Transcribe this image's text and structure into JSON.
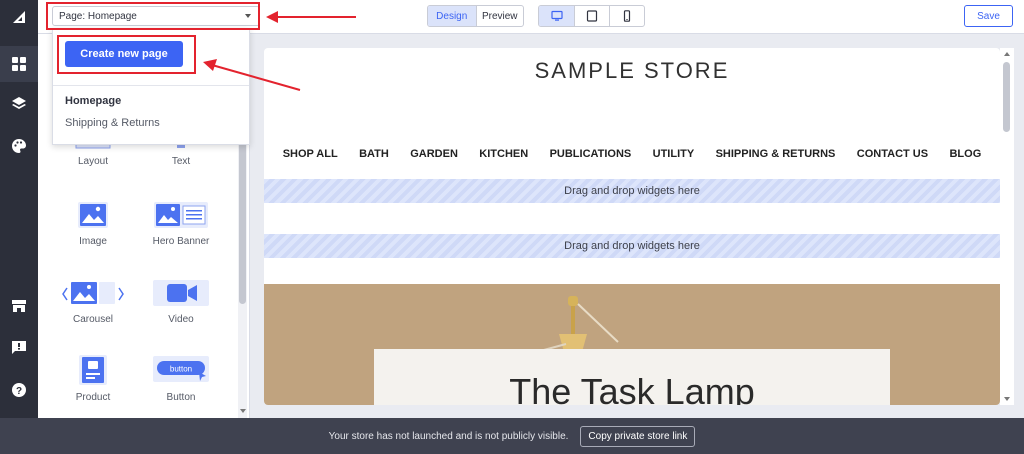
{
  "topbar": {
    "page_select_value": "Page: Homepage",
    "mode_design": "Design",
    "mode_preview": "Preview",
    "save_label": "Save"
  },
  "dropdown": {
    "create_label": "Create new page",
    "pages": [
      "Homepage",
      "Shipping & Returns"
    ]
  },
  "widgets": [
    {
      "label": "Layout",
      "icon": "layout-icon"
    },
    {
      "label": "Text",
      "icon": "text-icon"
    },
    {
      "label": "Image",
      "icon": "image-icon"
    },
    {
      "label": "Hero Banner",
      "icon": "hero-banner-icon"
    },
    {
      "label": "Carousel",
      "icon": "carousel-icon"
    },
    {
      "label": "Video",
      "icon": "video-icon"
    },
    {
      "label": "Product",
      "icon": "product-icon"
    },
    {
      "label": "Button",
      "icon": "button-icon",
      "button_text": "button"
    }
  ],
  "store": {
    "title": "SAMPLE STORE",
    "nav": [
      "SHOP ALL",
      "BATH",
      "GARDEN",
      "KITCHEN",
      "PUBLICATIONS",
      "UTILITY",
      "SHIPPING & RETURNS",
      "CONTACT US",
      "BLOG"
    ],
    "dropzone_text": "Drag and drop widgets here",
    "hero_title": "The Task Lamp"
  },
  "notice": {
    "message": "Your store has not launched and is not publicly visible.",
    "copy_label": "Copy private store link"
  },
  "colors": {
    "accent": "#3c64f4",
    "annotation": "#e3232e",
    "rail": "#2c2f3a"
  }
}
